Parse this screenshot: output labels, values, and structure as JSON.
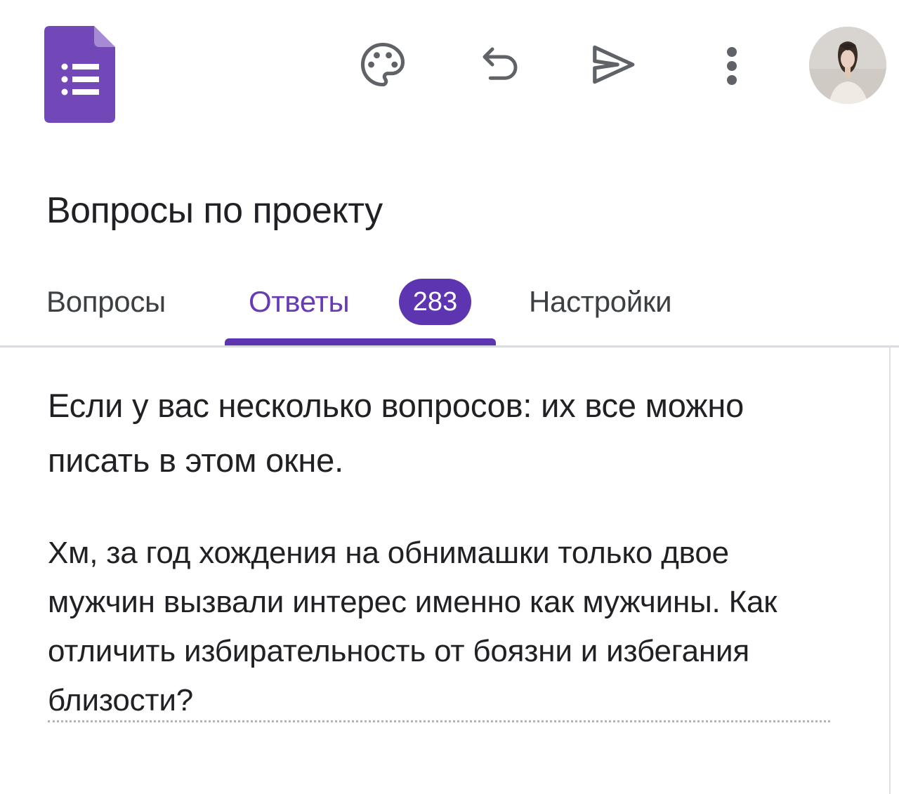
{
  "form": {
    "title": "Вопросы по проекту"
  },
  "tabs": [
    {
      "label": "Вопросы",
      "active": false
    },
    {
      "label": "Ответы",
      "active": true,
      "badge": "283"
    },
    {
      "label": "Настройки",
      "active": false
    }
  ],
  "toolbar": {
    "icons": [
      "palette-icon",
      "undo-icon",
      "send-icon",
      "more-vert-icon"
    ]
  },
  "question": {
    "text": "Если у вас несколько вопросов: их все можно писать в этом окне."
  },
  "answer": {
    "text": "Хм, за год хождения на обнимашки только двое мужчин вызвали интерес именно как мужчины. Как отличить избирательность от боязни и избегания близости?"
  },
  "colors": {
    "accent": "#673ab7",
    "badge": "#5e35b1",
    "text": "#202124",
    "icon": "#5f6368",
    "divider": "#dadce0"
  }
}
